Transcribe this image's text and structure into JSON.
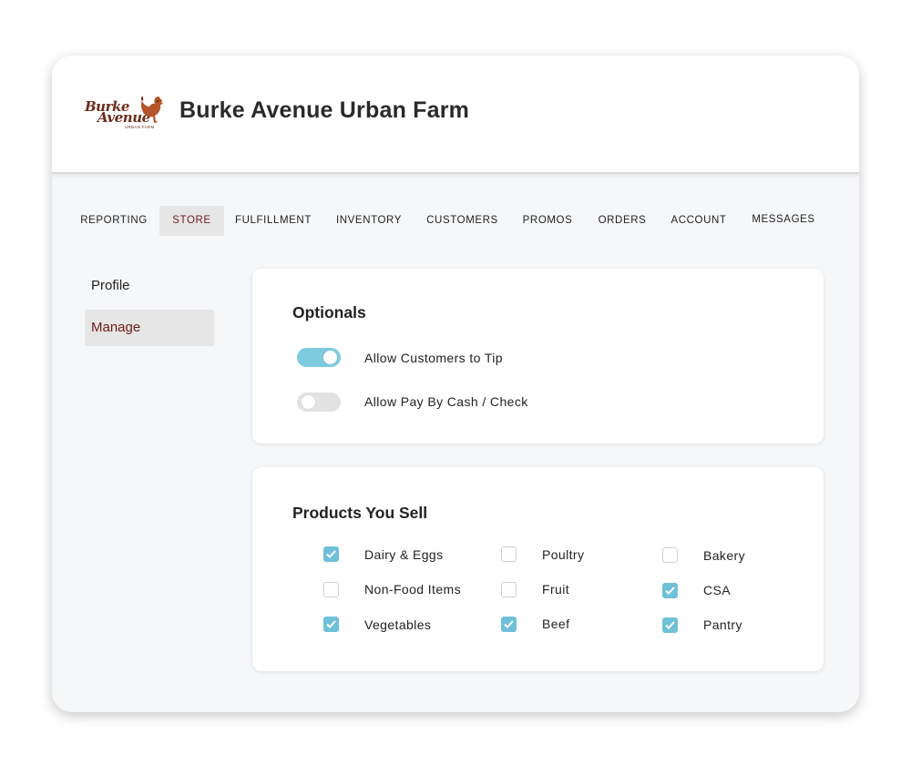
{
  "header": {
    "logo": {
      "line1": "Burke",
      "line2": "Avenue",
      "tagline": "URBAN FARM"
    },
    "title": "Burke Avenue Urban Farm"
  },
  "nav": {
    "tabs": [
      {
        "label": "REPORTING"
      },
      {
        "label": "STORE",
        "active": true
      },
      {
        "label": "FULFILLMENT"
      },
      {
        "label": "INVENTORY"
      },
      {
        "label": "CUSTOMERS"
      },
      {
        "label": "PROMOS"
      },
      {
        "label": "ORDERS"
      },
      {
        "label": "ACCOUNT"
      },
      {
        "label": "MESSAGES"
      }
    ]
  },
  "sidebar": {
    "items": [
      {
        "label": "Profile"
      },
      {
        "label": "Manage",
        "active": true
      }
    ]
  },
  "optionals": {
    "title": "Optionals",
    "toggles": [
      {
        "label": "Allow Customers to Tip",
        "on": true
      },
      {
        "label": "Allow Pay By Cash / Check",
        "on": false
      }
    ]
  },
  "products": {
    "title": "Products You Sell",
    "items": [
      {
        "label": "Dairy & Eggs",
        "checked": true
      },
      {
        "label": "Poultry",
        "checked": false
      },
      {
        "label": "Bakery",
        "checked": false
      },
      {
        "label": "Non-Food Items",
        "checked": false
      },
      {
        "label": "Fruit",
        "checked": false
      },
      {
        "label": "CSA",
        "checked": true
      },
      {
        "label": "Vegetables",
        "checked": true
      },
      {
        "label": "Beef",
        "checked": true
      },
      {
        "label": "Pantry",
        "checked": true
      }
    ]
  },
  "colors": {
    "accent": "#7ecbe0",
    "checkbox_checked": "#6fc0d8",
    "brand": "#6e1a1a"
  }
}
